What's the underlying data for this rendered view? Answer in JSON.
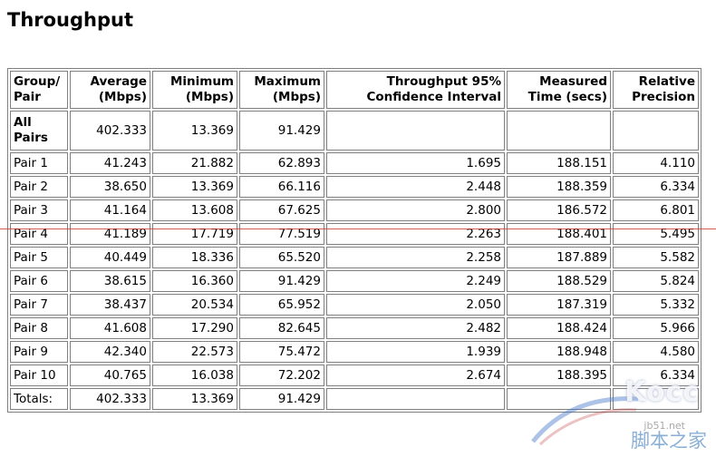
{
  "page": {
    "title": "Throughput"
  },
  "table": {
    "headers": [
      "Group/ Pair",
      "Average (Mbps)",
      "Minimum (Mbps)",
      "Maximum (Mbps)",
      "Throughput 95% Confidence Interval",
      "Measured Time (secs)",
      "Relative Precision"
    ],
    "all_row": {
      "label": "All Pairs",
      "average": "402.333",
      "minimum": "13.369",
      "maximum": "91.429",
      "confidence": "",
      "measured": "",
      "precision": ""
    },
    "rows": [
      {
        "label": "Pair 1",
        "average": "41.243",
        "minimum": "21.882",
        "maximum": "62.893",
        "confidence": "1.695",
        "measured": "188.151",
        "precision": "4.110"
      },
      {
        "label": "Pair 2",
        "average": "38.650",
        "minimum": "13.369",
        "maximum": "66.116",
        "confidence": "2.448",
        "measured": "188.359",
        "precision": "6.334"
      },
      {
        "label": "Pair 3",
        "average": "41.164",
        "minimum": "13.608",
        "maximum": "67.625",
        "confidence": "2.800",
        "measured": "186.572",
        "precision": "6.801"
      },
      {
        "label": "Pair 4",
        "average": "41.189",
        "minimum": "17.719",
        "maximum": "77.519",
        "confidence": "2.263",
        "measured": "188.401",
        "precision": "5.495"
      },
      {
        "label": "Pair 5",
        "average": "40.449",
        "minimum": "18.336",
        "maximum": "65.520",
        "confidence": "2.258",
        "measured": "187.889",
        "precision": "5.582"
      },
      {
        "label": "Pair 6",
        "average": "38.615",
        "minimum": "16.360",
        "maximum": "91.429",
        "confidence": "2.249",
        "measured": "188.529",
        "precision": "5.824"
      },
      {
        "label": "Pair 7",
        "average": "38.437",
        "minimum": "20.534",
        "maximum": "65.952",
        "confidence": "2.050",
        "measured": "187.319",
        "precision": "5.332"
      },
      {
        "label": "Pair 8",
        "average": "41.608",
        "minimum": "17.290",
        "maximum": "82.645",
        "confidence": "2.482",
        "measured": "188.424",
        "precision": "5.966"
      },
      {
        "label": "Pair 9",
        "average": "42.340",
        "minimum": "22.573",
        "maximum": "75.472",
        "confidence": "1.939",
        "measured": "188.948",
        "precision": "4.580"
      },
      {
        "label": "Pair 10",
        "average": "40.765",
        "minimum": "16.038",
        "maximum": "72.202",
        "confidence": "2.674",
        "measured": "188.395",
        "precision": "6.334"
      }
    ],
    "totals": {
      "label": "Totals:",
      "average": "402.333",
      "minimum": "13.369",
      "maximum": "91.429",
      "confidence": "",
      "measured": "",
      "precision": ""
    }
  },
  "watermark": {
    "main": "Kocc",
    "site": "jb51.net",
    "sub": "脚本之家"
  },
  "colors": {
    "border": "#808080",
    "redline": "#c0392b"
  }
}
